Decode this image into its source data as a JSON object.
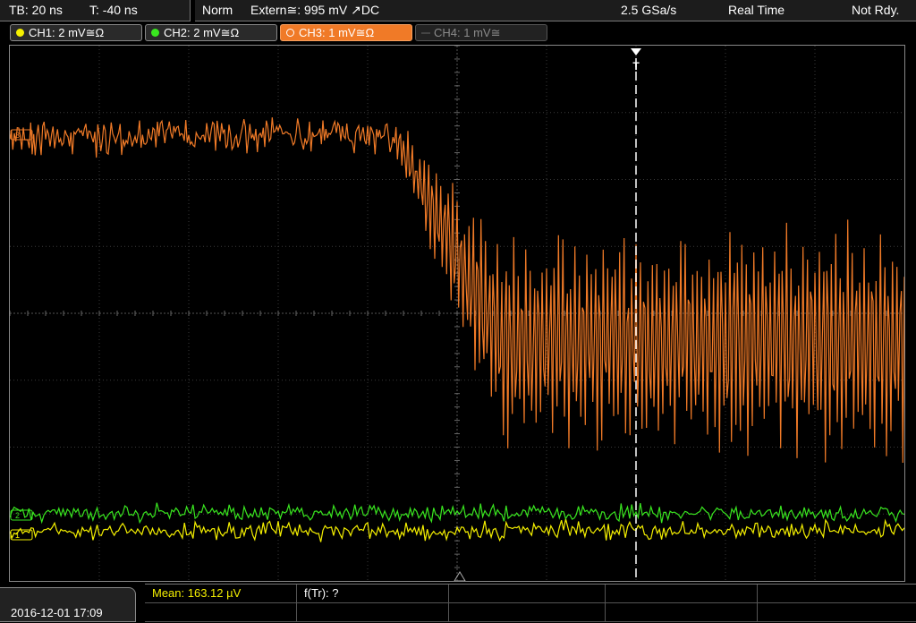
{
  "topbar": {
    "timebase": "TB: 20 ns",
    "trigger_time": "T: -40 ns",
    "mode": "Norm",
    "trigger_source": "Extern≅: 995 mV ↗DC",
    "sample_rate": "2.5 GSa/s",
    "acq_mode": "Real Time",
    "status": "Not Rdy."
  },
  "channels": [
    {
      "label": "CH1: 2 mV≅Ω",
      "color": "#f5f000",
      "state": "on"
    },
    {
      "label": "CH2: 2 mV≅Ω",
      "color": "#39e61f",
      "state": "on"
    },
    {
      "label": "CH3: 1 mV≅Ω",
      "color": "#f07a27",
      "state": "active"
    },
    {
      "label": "CH4: 1 mV≅",
      "color": "#555555",
      "state": "off"
    }
  ],
  "markers": {
    "trigger": "T",
    "ch3": "3",
    "ch2": "2",
    "ch1": "1"
  },
  "bottom": {
    "datetime": "2016-12-01 17:09",
    "meas1": "Mean: 163.12 µV",
    "meas1_color": "#f5f000",
    "meas2": "f(Tr): ?"
  }
}
